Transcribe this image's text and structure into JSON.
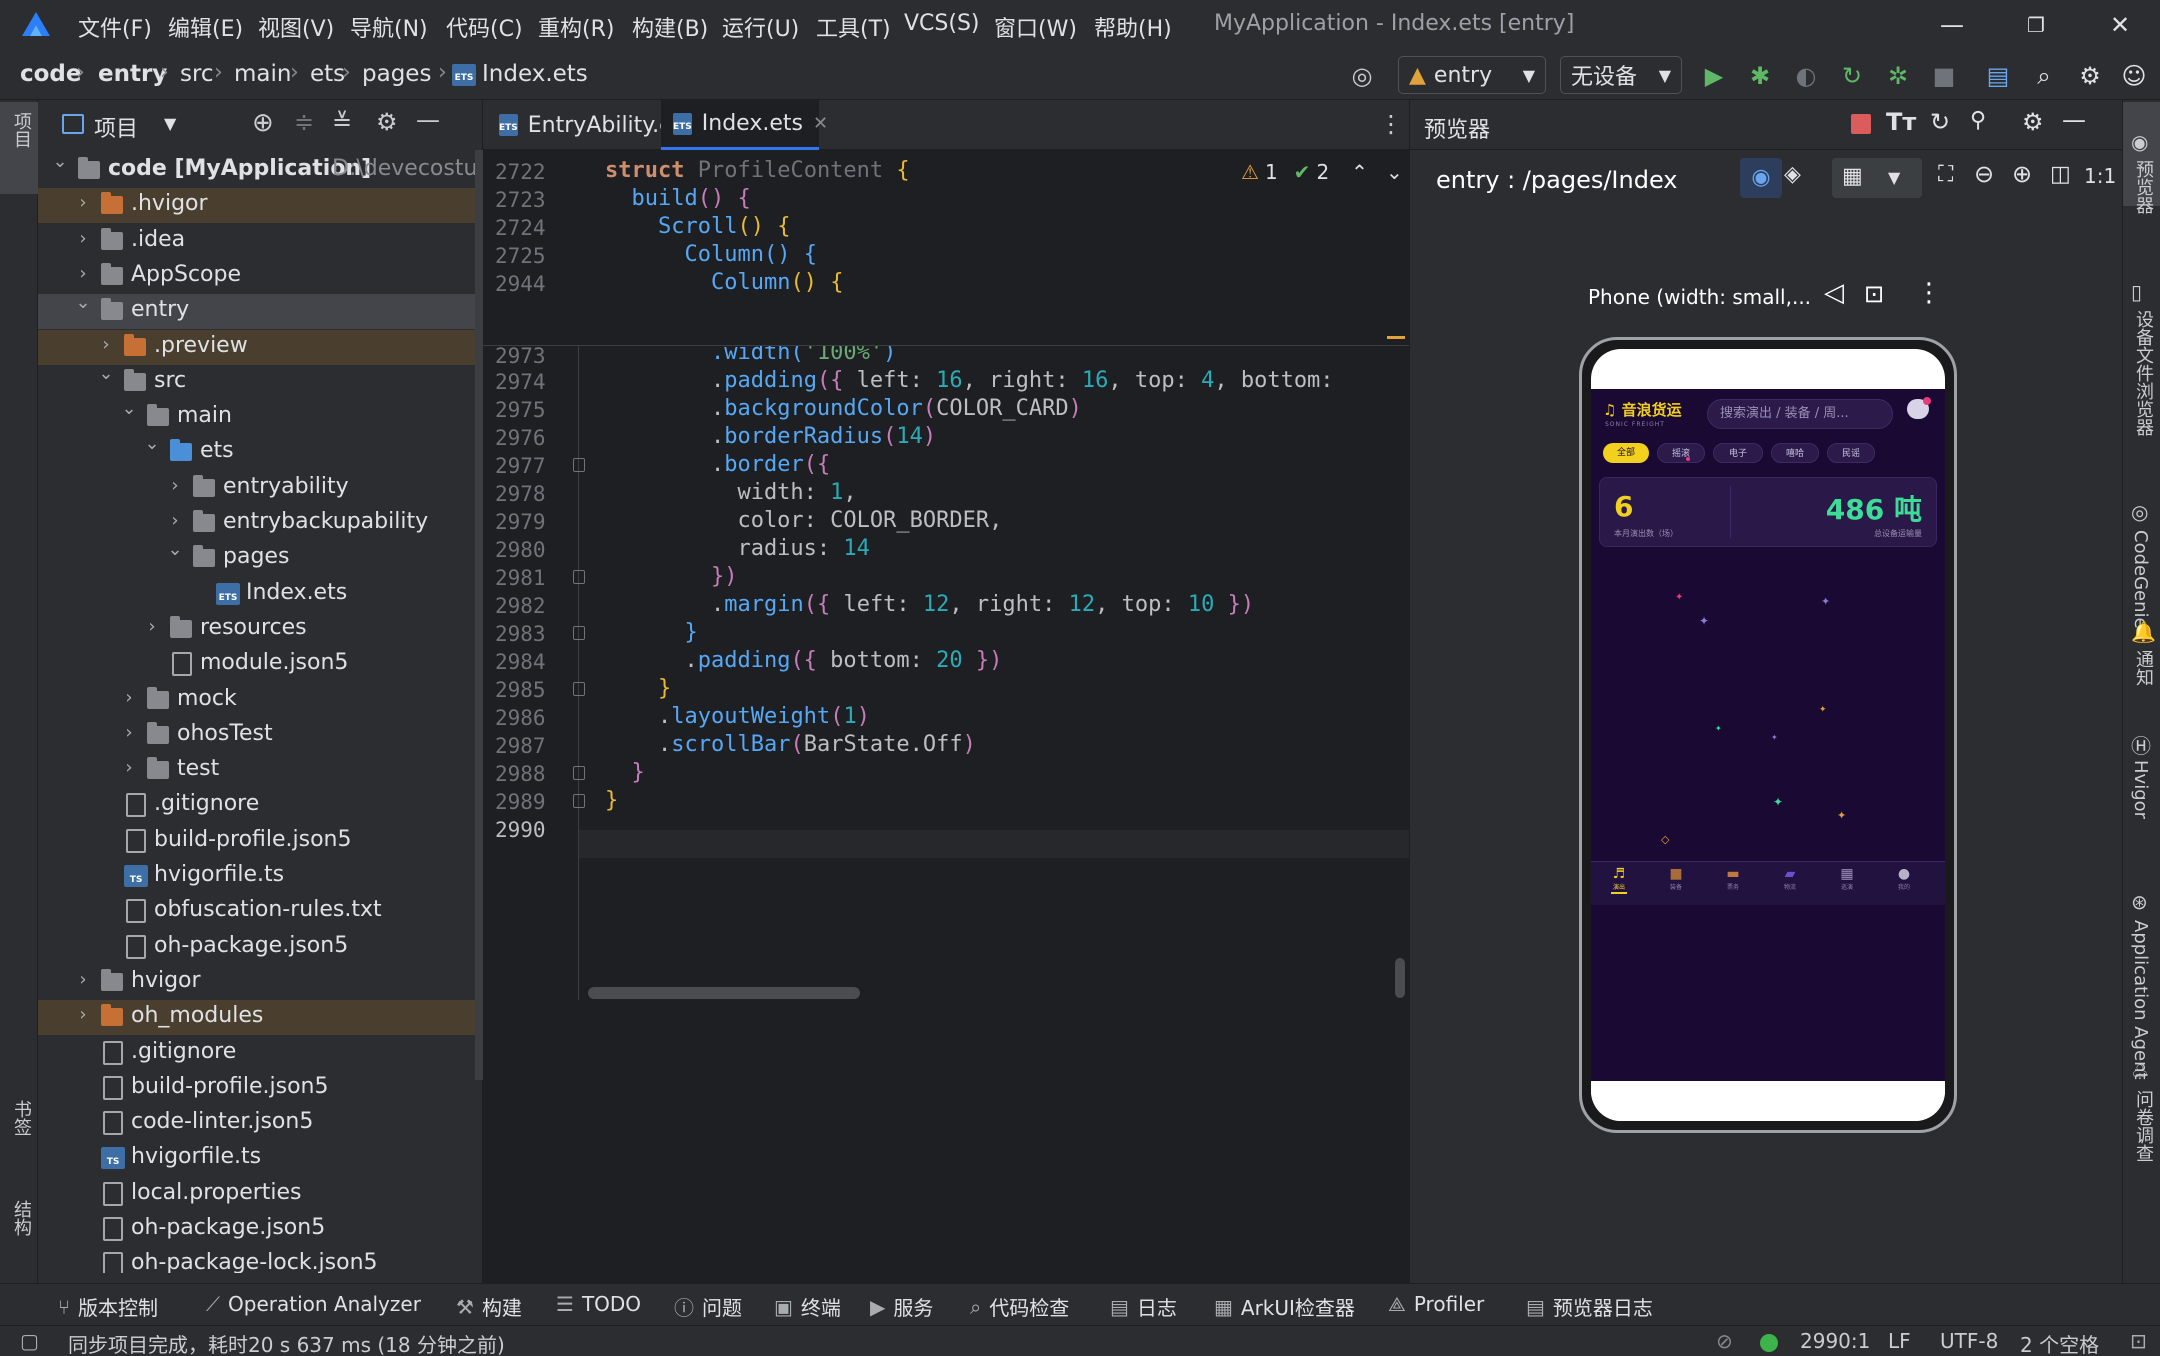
{
  "titlebar": {
    "menus": [
      "文件(F)",
      "编辑(E)",
      "视图(V)",
      "导航(N)",
      "代码(C)",
      "重构(R)",
      "构建(B)",
      "运行(U)",
      "工具(T)",
      "VCS(S)",
      "窗口(W)",
      "帮助(H)"
    ],
    "window_title": "MyApplication - Index.ets [entry]"
  },
  "navbar": {
    "breadcrumbs": [
      "code",
      "entry",
      "src",
      "main",
      "ets",
      "pages",
      "Index.ets"
    ],
    "run_config": "entry",
    "device": "无设备"
  },
  "left_strip": {
    "project": "项目",
    "bookmarks": "书签",
    "structure": "结构"
  },
  "project_panel": {
    "title": "项目",
    "tree": [
      {
        "label": "code [MyApplication]",
        "hint": "D:\\devecostu",
        "indent": 0,
        "kind": "root",
        "open": true
      },
      {
        "label": ".hvigor",
        "indent": 1,
        "kind": "folder-orange",
        "open": false
      },
      {
        "label": ".idea",
        "indent": 1,
        "kind": "folder",
        "open": false
      },
      {
        "label": "AppScope",
        "indent": 1,
        "kind": "folder",
        "open": false
      },
      {
        "label": "entry",
        "indent": 1,
        "kind": "folder-mod",
        "open": true
      },
      {
        "label": ".preview",
        "indent": 2,
        "kind": "folder-orange",
        "open": false
      },
      {
        "label": "src",
        "indent": 2,
        "kind": "folder",
        "open": true
      },
      {
        "label": "main",
        "indent": 3,
        "kind": "folder",
        "open": true
      },
      {
        "label": "ets",
        "indent": 4,
        "kind": "folder-blue",
        "open": true
      },
      {
        "label": "entryability",
        "indent": 5,
        "kind": "folder",
        "open": false
      },
      {
        "label": "entrybackupability",
        "indent": 5,
        "kind": "folder",
        "open": false
      },
      {
        "label": "pages",
        "indent": 5,
        "kind": "folder",
        "open": true
      },
      {
        "label": "Index.ets",
        "indent": 6,
        "kind": "ets"
      },
      {
        "label": "resources",
        "indent": 4,
        "kind": "folder",
        "open": false
      },
      {
        "label": "module.json5",
        "indent": 4,
        "kind": "file"
      },
      {
        "label": "mock",
        "indent": 3,
        "kind": "folder",
        "open": false
      },
      {
        "label": "ohosTest",
        "indent": 3,
        "kind": "folder",
        "open": false
      },
      {
        "label": "test",
        "indent": 3,
        "kind": "folder",
        "open": false
      },
      {
        "label": ".gitignore",
        "indent": 2,
        "kind": "file"
      },
      {
        "label": "build-profile.json5",
        "indent": 2,
        "kind": "file"
      },
      {
        "label": "hvigorfile.ts",
        "indent": 2,
        "kind": "ts"
      },
      {
        "label": "obfuscation-rules.txt",
        "indent": 2,
        "kind": "file"
      },
      {
        "label": "oh-package.json5",
        "indent": 2,
        "kind": "file"
      },
      {
        "label": "hvigor",
        "indent": 1,
        "kind": "folder",
        "open": false
      },
      {
        "label": "oh_modules",
        "indent": 1,
        "kind": "folder-orange",
        "open": false
      },
      {
        "label": ".gitignore",
        "indent": 1,
        "kind": "file"
      },
      {
        "label": "build-profile.json5",
        "indent": 1,
        "kind": "file"
      },
      {
        "label": "code-linter.json5",
        "indent": 1,
        "kind": "file"
      },
      {
        "label": "hvigorfile.ts",
        "indent": 1,
        "kind": "ts"
      },
      {
        "label": "local.properties",
        "indent": 1,
        "kind": "file"
      },
      {
        "label": "oh-package.json5",
        "indent": 1,
        "kind": "file"
      },
      {
        "label": "oh-package-lock.json5",
        "indent": 1,
        "kind": "file"
      }
    ]
  },
  "editor": {
    "tabs": [
      {
        "label": "EntryAbility.ets",
        "active": false
      },
      {
        "label": "Index.ets",
        "active": true
      }
    ],
    "inspections": {
      "warnings": "1",
      "ok": "2"
    },
    "sticky_lines": [
      {
        "num": "2722",
        "html": "<span class='kw'>struct</span> <span class='type'>ProfileContent</span> <span class='punc2'>{</span>"
      },
      {
        "num": "2723",
        "html": "  <span class='fn'>build</span><span class='punc'>()</span> <span class='punc'>{</span>"
      },
      {
        "num": "2724",
        "html": "    <span class='fn'>Scroll</span><span class='punc2'>()</span> <span class='punc2'>{</span>"
      },
      {
        "num": "2725",
        "html": "      <span class='fn'>Column</span><span class='fn'>()</span> <span class='fn'>{</span>"
      },
      {
        "num": "2944",
        "html": "        <span class='fn'>Column</span><span class='punc2'>()</span> <span class='punc2'>{</span>"
      }
    ],
    "lines": [
      {
        "num": "2974",
        "html": "        .<span class='fn'>padding</span><span class='punc'>({</span> left: <span class='num'>16</span>, right: <span class='num'>16</span>, top: <span class='num'>4</span>, bottom: "
      },
      {
        "num": "2975",
        "html": "        .<span class='fn'>backgroundColor</span><span class='punc'>(</span>COLOR_CARD<span class='punc'>)</span>"
      },
      {
        "num": "2976",
        "html": "        .<span class='fn'>borderRadius</span><span class='punc'>(</span><span class='num'>14</span><span class='punc'>)</span>"
      },
      {
        "num": "2977",
        "html": "        .<span class='fn'>border</span><span class='punc'>({</span>"
      },
      {
        "num": "2978",
        "html": "          width: <span class='num'>1</span>,"
      },
      {
        "num": "2979",
        "html": "          color: COLOR_BORDER,"
      },
      {
        "num": "2980",
        "html": "          radius: <span class='num'>14</span>"
      },
      {
        "num": "2981",
        "html": "        <span class='punc'>})</span>"
      },
      {
        "num": "2982",
        "html": "        .<span class='fn'>margin</span><span class='punc'>({</span> left: <span class='num'>12</span>, right: <span class='num'>12</span>, top: <span class='num'>10</span> <span class='punc'>})</span>"
      },
      {
        "num": "2983",
        "html": "      <span class='fn'>}</span>"
      },
      {
        "num": "2984",
        "html": "      .<span class='fn'>padding</span><span class='punc'>({</span> bottom: <span class='num'>20</span> <span class='punc'>})</span>"
      },
      {
        "num": "2985",
        "html": "    <span class='punc2'>}</span>"
      },
      {
        "num": "2986",
        "html": "    .<span class='fn'>layoutWeight</span><span class='punc'>(</span><span class='num'>1</span><span class='punc'>)</span>"
      },
      {
        "num": "2987",
        "html": "    .<span class='fn'>scrollBar</span><span class='punc'>(</span>BarState.Off<span class='punc'>)</span>"
      },
      {
        "num": "2988",
        "html": "  <span class='punc'>}</span>"
      },
      {
        "num": "2989",
        "html": "<span class='punc2'>}</span>"
      },
      {
        "num": "2990",
        "html": ""
      }
    ],
    "partial_line": ".width('100%')",
    "partial_num": "2973"
  },
  "preview": {
    "title": "预览器",
    "route": "entry : /pages/Index",
    "device_label": "Phone (width: small,...",
    "app": {
      "name": "音浪货运",
      "subtitle": "SONIC FREIGHT",
      "search_placeholder": "搜索演出 / 装备 / 周...",
      "filters": [
        "全部",
        "摇滚",
        "电子",
        "嘻哈",
        "民谣"
      ],
      "stat_left_value": "6",
      "stat_left_label": "本月演出数（场）",
      "stat_right_value": "486 吨",
      "stat_right_label": "总设备运输量",
      "bottom_nav": [
        "演出",
        "装备",
        "票务",
        "物流",
        "巡演",
        "我的"
      ],
      "accent": "#f2d01e",
      "green": "#3ddc97"
    }
  },
  "right_strip": [
    "预览器",
    "设备文件浏览器",
    "CodeGenie",
    "通知",
    "Hvigor",
    "Application Agent",
    "问卷调查"
  ],
  "bottom_tools": [
    "版本控制",
    "Operation Analyzer",
    "构建",
    "TODO",
    "问题",
    "终端",
    "服务",
    "代码检查",
    "日志",
    "ArkUI检查器",
    "Profiler",
    "预览器日志"
  ],
  "status": {
    "message": "同步项目完成，耗时20 s 637 ms (18 分钟之前)",
    "position": "2990:1",
    "line_sep": "LF",
    "encoding": "UTF-8",
    "indent": "2 个空格"
  }
}
